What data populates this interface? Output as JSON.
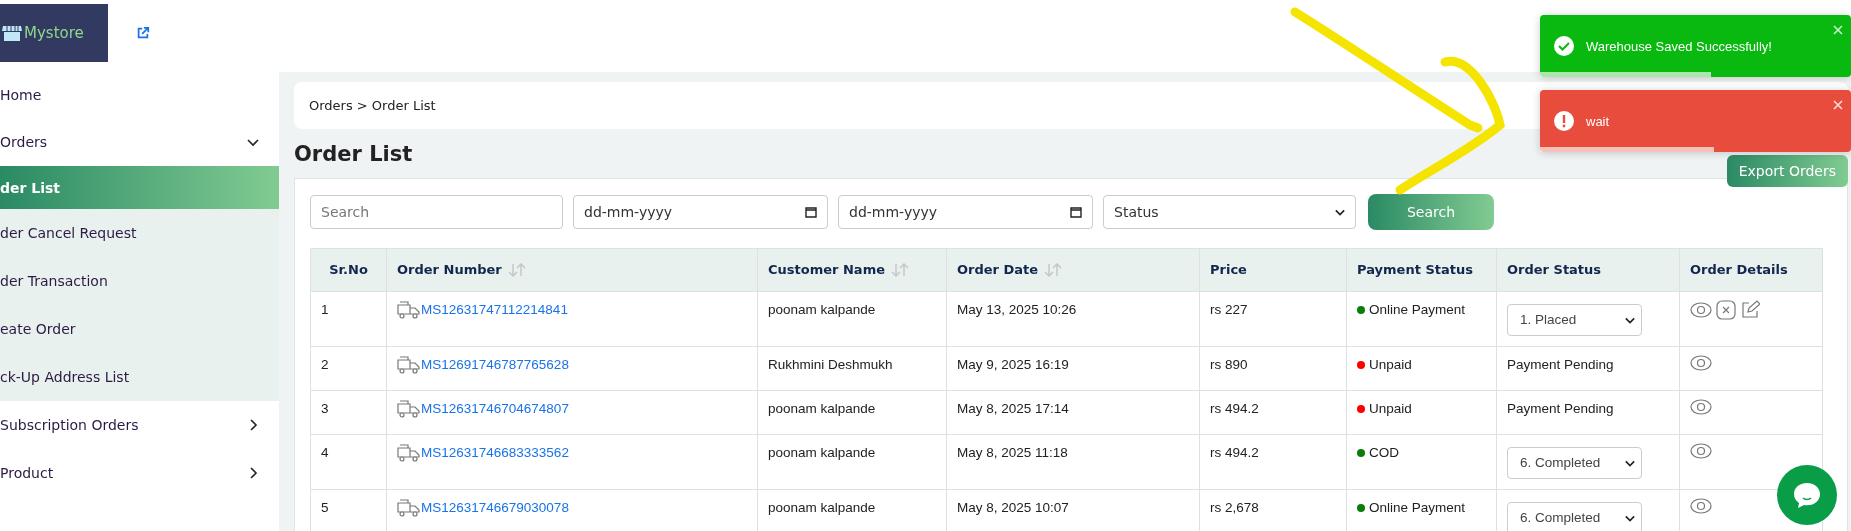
{
  "brand": {
    "name": "Mystore"
  },
  "sidebar": {
    "items": [
      {
        "label": "Home",
        "kind": "link"
      },
      {
        "label": "Orders",
        "kind": "group",
        "expanded": true,
        "children": [
          {
            "label": "der List",
            "selected": true
          },
          {
            "label": "der Cancel Request",
            "selected": false
          },
          {
            "label": "der Transaction",
            "selected": false
          },
          {
            "label": "eate Order",
            "selected": false
          },
          {
            "label": "ck-Up Address List",
            "selected": false
          }
        ]
      },
      {
        "label": "Subscription Orders",
        "kind": "group",
        "expanded": false
      },
      {
        "label": "Product",
        "kind": "group",
        "expanded": false
      }
    ]
  },
  "breadcrumb": "Orders > Order List",
  "page_title": "Order List",
  "export_button": "Export Orders",
  "filters": {
    "search_placeholder": "Search",
    "date_from": "dd-mm-yyyy",
    "date_to": "dd-mm-yyyy",
    "status": "Status",
    "button": "Search"
  },
  "table": {
    "columns": [
      {
        "label": "Sr.No",
        "sortable": false
      },
      {
        "label": "Order Number",
        "sortable": true
      },
      {
        "label": "Customer Name",
        "sortable": true
      },
      {
        "label": "Order Date",
        "sortable": true
      },
      {
        "label": "Price",
        "sortable": false
      },
      {
        "label": "Payment Status",
        "sortable": false
      },
      {
        "label": "Order Status",
        "sortable": false
      },
      {
        "label": "Order Details",
        "sortable": false
      }
    ],
    "rows": [
      {
        "sr": "1",
        "order_number": "MS12631747112214841",
        "customer": "poonam kalpande",
        "date": "May 13, 2025 10:26",
        "price": "rs 227",
        "payment": {
          "label": "Online Payment",
          "color": "#0a7d0a"
        },
        "order_status": {
          "kind": "select",
          "value": "1. Placed"
        },
        "actions": [
          {
            "kind": "view"
          },
          {
            "kind": "cancel"
          },
          {
            "kind": "edit"
          }
        ]
      },
      {
        "sr": "2",
        "order_number": "MS12691746787765628",
        "customer": "Rukhmini Deshmukh",
        "date": "May 9, 2025 16:19",
        "price": "rs 890",
        "payment": {
          "label": "Unpaid",
          "color": "#ff0000"
        },
        "order_status": {
          "kind": "text",
          "value": "Payment Pending"
        },
        "actions": [
          {
            "kind": "view"
          }
        ]
      },
      {
        "sr": "3",
        "order_number": "MS12631746704674807",
        "customer": "poonam kalpande",
        "date": "May 8, 2025 17:14",
        "price": "rs 494.2",
        "payment": {
          "label": "Unpaid",
          "color": "#ff0000"
        },
        "order_status": {
          "kind": "text",
          "value": "Payment Pending"
        },
        "actions": [
          {
            "kind": "view"
          }
        ]
      },
      {
        "sr": "4",
        "order_number": "MS12631746683333562",
        "customer": "poonam kalpande",
        "date": "May 8, 2025 11:18",
        "price": "rs 494.2",
        "payment": {
          "label": "COD",
          "color": "#0a7d0a"
        },
        "order_status": {
          "kind": "select",
          "value": "6. Completed"
        },
        "actions": [
          {
            "kind": "view"
          }
        ]
      },
      {
        "sr": "5",
        "order_number": "MS12631746679030078",
        "customer": "poonam kalpande",
        "date": "May 8, 2025 10:07",
        "price": "rs 2,678",
        "payment": {
          "label": "Online Payment",
          "color": "#0a7d0a"
        },
        "order_status": {
          "kind": "select",
          "value": "6. Completed"
        },
        "actions": [
          {
            "kind": "view"
          }
        ]
      }
    ]
  },
  "toasts": [
    {
      "kind": "success",
      "message": "Warehouse Saved Successfully!",
      "level": 0.55
    },
    {
      "kind": "error",
      "message": "wait",
      "level": 0.56
    }
  ]
}
